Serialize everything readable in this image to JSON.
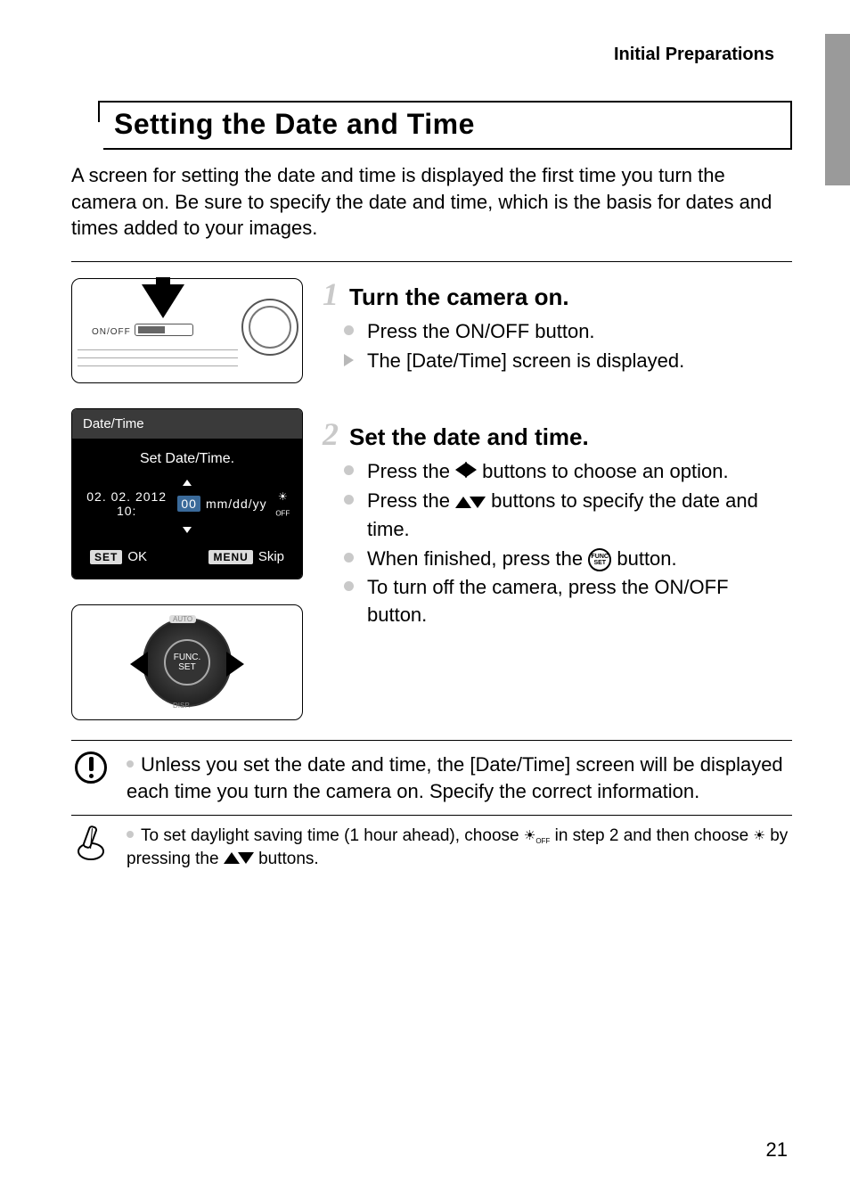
{
  "header": {
    "breadcrumb": "Initial Preparations"
  },
  "section": {
    "title": "Setting the Date and Time",
    "intro": "A screen for setting the date and time is displayed the first time you turn the camera on. Be sure to specify the date and time, which is the basis for dates and times added to your images."
  },
  "fig_power": {
    "label": "ON/OFF"
  },
  "fig_datetime": {
    "title": "Date/Time",
    "subtitle": "Set Date/Time.",
    "date_seg1": "02. 02. 2012 10:",
    "date_seg_hi": "00",
    "date_seg2": "mm/dd/yy",
    "dst": "OFF",
    "ok_btn": "SET",
    "ok_label": "OK",
    "skip_btn": "MENU",
    "skip_label": "Skip"
  },
  "fig_dial": {
    "center_top": "FUNC.",
    "center_bot": "SET",
    "top": "AUTO",
    "bot": "DISP."
  },
  "steps": [
    {
      "num": "1",
      "title": "Turn the camera on.",
      "items": [
        {
          "kind": "dot",
          "text": "Press the ON/OFF button."
        },
        {
          "kind": "tri",
          "text": "The [Date/Time] screen is displayed."
        }
      ]
    },
    {
      "num": "2",
      "title": "Set the date and time.",
      "items": [
        {
          "kind": "dot",
          "pre": "Press the ",
          "icon": "lr",
          "post": " buttons to choose an option."
        },
        {
          "kind": "dot",
          "pre": "Press the ",
          "icon": "ud",
          "post": " buttons to specify the date and time."
        },
        {
          "kind": "dot",
          "pre": "When finished, press the ",
          "icon": "func",
          "post": " button."
        },
        {
          "kind": "dot",
          "text": "To turn off the camera, press the ON/OFF button."
        }
      ]
    }
  ],
  "warning": {
    "text": "Unless you set the date and time, the [Date/Time] screen will be displayed each time you turn the camera on. Specify the correct information."
  },
  "tip": {
    "pre": "To set daylight saving time (1 hour ahead), choose ",
    "mid": " in step 2 and then choose ",
    "post": " by pressing the ",
    "post2": " buttons.",
    "dst_off": "OFF"
  },
  "page_number": "21"
}
